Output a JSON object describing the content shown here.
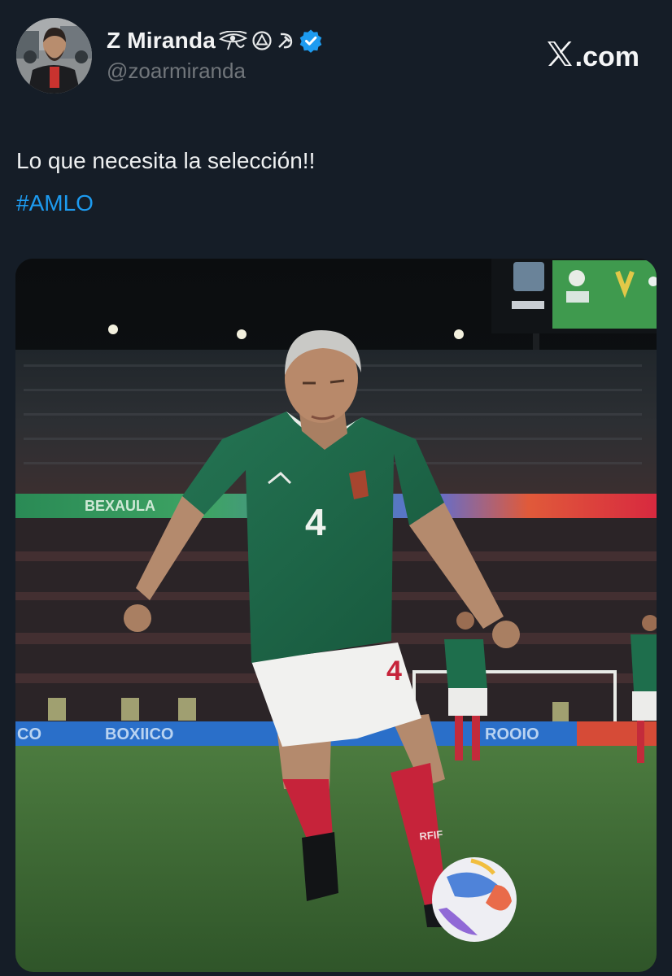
{
  "author": {
    "display_name": "Z Miranda",
    "handle": "@zoarmiranda",
    "name_icons": [
      "eye-of-horus-icon",
      "circle-triangle-icon",
      "hammer-sickle-icon",
      "verified-badge-icon"
    ]
  },
  "brand": {
    "label": ".com",
    "icon": "x-logo-icon"
  },
  "tweet": {
    "text": "Lo que necesita la selección!!",
    "hashtag": "#AMLO"
  },
  "media": {
    "player_number": "4",
    "board_text_left": "BEXAULA",
    "board_text_bottom_left": "BOXIICO",
    "board_text_bottom_right": "ROOIO",
    "sock_text": "RFIF",
    "colors": {
      "jersey": "#1f6b4a",
      "shorts": "#f1f1ef",
      "socks": "#c6233a",
      "pitch": "#3f6a36"
    }
  },
  "colors": {
    "background": "#151d27",
    "text": "#eef0f1",
    "secondary": "#71767b",
    "link": "#1d9bf0",
    "verified": "#1d9bf0"
  }
}
